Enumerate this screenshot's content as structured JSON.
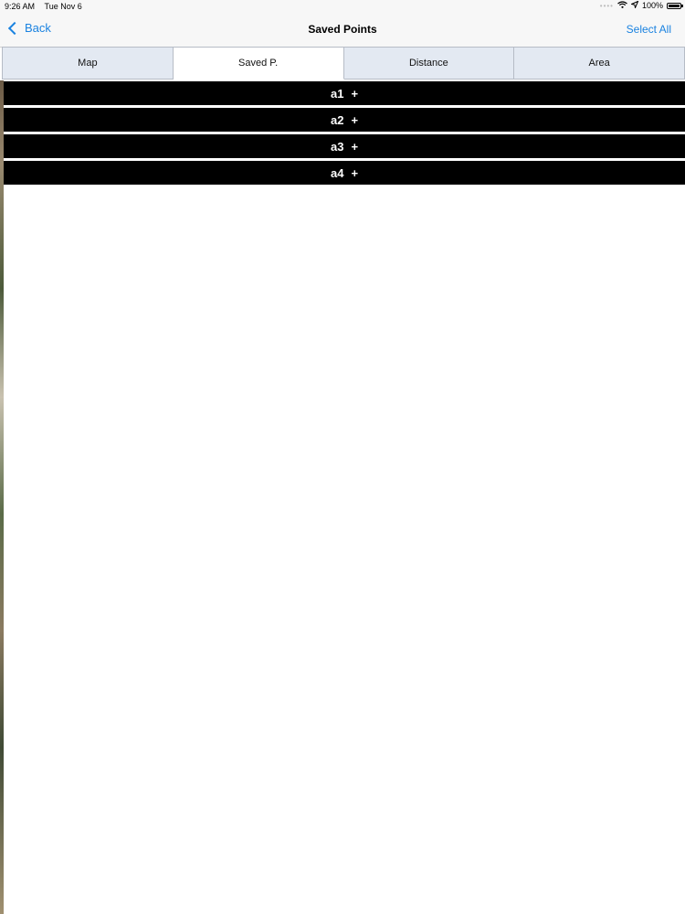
{
  "status_bar": {
    "time": "9:26 AM",
    "date": "Tue Nov 6",
    "battery": "100%",
    "battery_level": 1.0
  },
  "nav": {
    "back_label": "Back",
    "title": "Saved Points",
    "select_all_label": "Select All",
    "accent_color": "#1a82e0"
  },
  "tabs": [
    {
      "label": "Map",
      "active": false
    },
    {
      "label": "Saved P.",
      "active": true
    },
    {
      "label": "Distance",
      "active": false
    },
    {
      "label": "Area",
      "active": false
    }
  ],
  "saved_points": [
    {
      "label": "a1",
      "action": "+"
    },
    {
      "label": "a2",
      "action": "+"
    },
    {
      "label": "a3",
      "action": "+"
    },
    {
      "label": "a4",
      "action": "+"
    }
  ],
  "icons": {
    "back": "chevron-left-icon",
    "wifi": "wifi-icon",
    "location": "location-arrow-icon",
    "battery": "battery-icon"
  }
}
